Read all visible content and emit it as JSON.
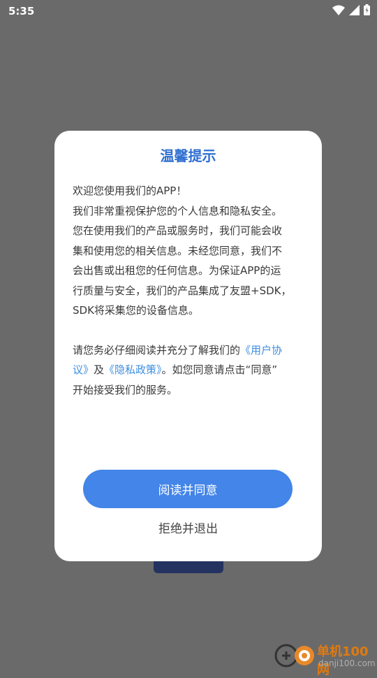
{
  "status_bar": {
    "time": "5:35"
  },
  "dialog": {
    "title": "温馨提示",
    "para1": [
      "欢迎您使用我们的APP！",
      "我们非常重视保护您的个人信息和隐私安全。",
      "您在使用我们的产品或服务时，我们可能会收",
      "集和使用您的相关信息。未经您同意，我们不",
      "会出售或出租您的任何信息。为保证APP的运",
      "行质量与安全，我们的产品集成了友盟+SDK，",
      "SDK将采集您的设备信息。"
    ],
    "para2": {
      "line1_text": "请您务必仔细阅读并充分了解我们的",
      "line1_link": "《用户协",
      "line2_link": "议》",
      "line2_and": "及",
      "line2_link2": "《隐私政策》",
      "line2_text": "。如您同意请点击“同意”",
      "line3_text": "开始接受我们的服务。"
    },
    "agree_label": "阅读并同意",
    "reject_label": "拒绝并退出"
  },
  "watermark": {
    "brand": "单机100网",
    "url": "danji100.com"
  }
}
